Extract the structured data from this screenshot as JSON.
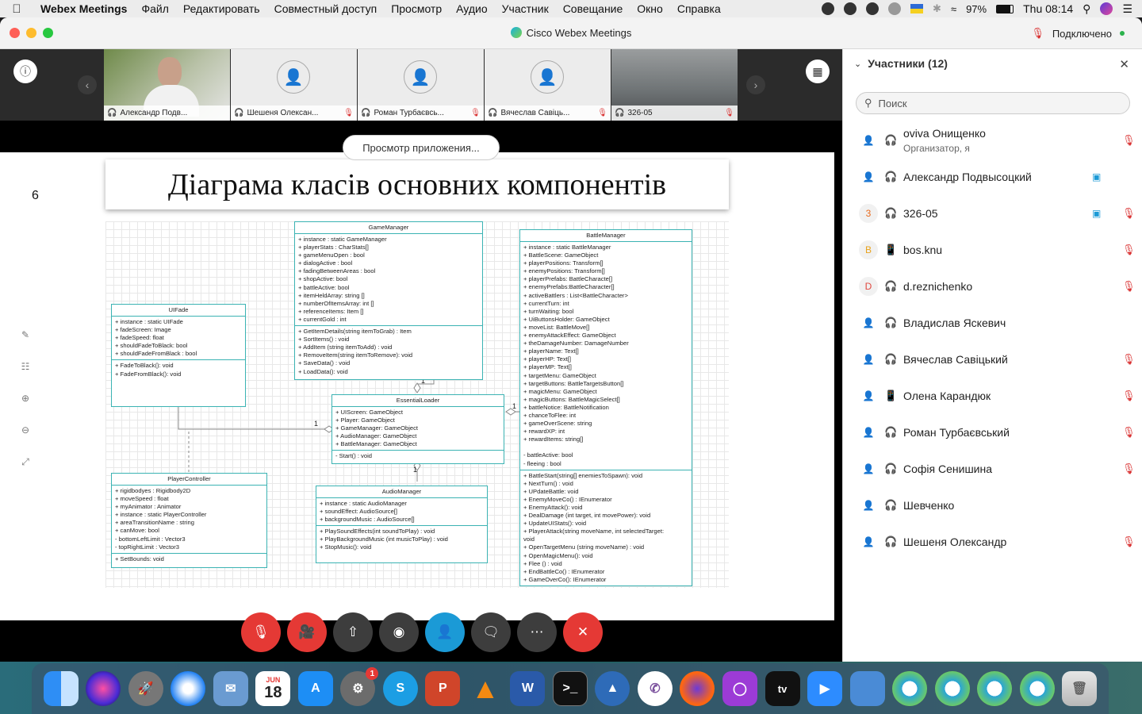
{
  "menubar": {
    "app": "Webex Meetings",
    "items": [
      "Файл",
      "Редактировать",
      "Совместный доступ",
      "Просмотр",
      "Аудио",
      "Участник",
      "Совещание",
      "Окно",
      "Справка"
    ],
    "battery": "97%",
    "clock": "Thu 08:14"
  },
  "window": {
    "title": "Cisco Webex Meetings",
    "status": "Подключено"
  },
  "video_tiles": [
    {
      "name": "Александр Подв...",
      "muted": false
    },
    {
      "name": "Шешеня Олексан...",
      "muted": true
    },
    {
      "name": "Роман Турбаєвсь...",
      "muted": true
    },
    {
      "name": "Вячеслав Савіць...",
      "muted": true
    },
    {
      "name": "326-05",
      "muted": true
    }
  ],
  "share": {
    "view_app_label": "Просмотр приложения..."
  },
  "slide": {
    "number": "6",
    "title": "Діаграма класів основних компонентів",
    "classes": {
      "gamemanager": {
        "name": "GameManager",
        "fields": [
          "+ instance : static GameManager",
          "+ playerStats : CharStats[]",
          "+ gameMenuOpen : bool",
          "+ dialogActive : bool",
          "+ fadingBetweenAreas : bool",
          "+ shopActive: bool",
          "+ battleActive: bool",
          "+ itemHeldArray: string []",
          "+ numberOfItemsArray: int []",
          "+ referenceItems: Item []",
          "+ currentGold : int"
        ],
        "methods": [
          "+ GetItemDetails(string itemToGrab) : Item",
          "+ SortItems() : void",
          "+ AddItem (string itemToAdd) : void",
          "+ RemoveItem(string itemToRemove): void",
          "+ SaveData() : void",
          "+ LoadData(): void"
        ]
      },
      "uifade": {
        "name": "UIFade",
        "fields": [
          "+ instance : static UIFade",
          "+ fadeScreen: Image",
          "+ fadeSpeed: float",
          "+ shouldFadeToBlack: bool",
          "+ shouldFadeFromBlack : bool"
        ],
        "methods": [
          "+ FadeToBlack(): void",
          "+ FadeFromBlack(): void"
        ]
      },
      "essentialloader": {
        "name": "EssentialLoader",
        "fields": [
          "+ UIScreen: GameObject",
          "+ Player: GameObject",
          "+ GameManager: GameObject",
          "+ AudioManager: GameObject",
          "+ BattleManager: GameObject"
        ],
        "methods": [
          "- Start() : void"
        ]
      },
      "playercontroller": {
        "name": "PlayerController",
        "fields": [
          "+ rigidbodyes : Rigidbody2D",
          "+ moveSpeed : float",
          "+ myAnimator : Animator",
          "+ instance : static PlayerController",
          "+ areaTransitionName : string",
          "+ canMove: bool",
          "- bottomLeftLimit : Vector3",
          "- topRightLimit : Vector3"
        ],
        "methods": [
          "+ SetBounds: void"
        ]
      },
      "audiomanager": {
        "name": "AudioManager",
        "fields": [
          "+ instance :  static AudioManager",
          "+ soundEffect: AudioSource[]",
          "+ backgroundMusic : AudioSource[]"
        ],
        "methods": [
          "+ PlaySoundEffects(int soundToPlay) : void",
          "+ PlayBackgroundMusic (int musicToPlay) : void",
          "+ StopMusic(): void"
        ]
      },
      "battlemanager": {
        "name": "BattleManager",
        "fields": [
          "+ instance : static BattleManager",
          "+ BattleScene: GameObject",
          "+ playerPositions: Transform[]",
          "+ enemyPositions: Transform[]",
          "+ playerPrefabs: BattleCharacte[]",
          "+ enemyPrefabs:BattleCharacter[]",
          "+ activeBattlers : List<BattleCharacter>",
          "+ currentTurn: int",
          "+ turnWaiting: bool",
          "+ UiButtonsHolder: GameObject",
          "+ moveList: BattleMove[]",
          "+ enemyAttackEffect: GameObject",
          "+ theDamageNumber: DamageNumber",
          "+ playerName: Text[]",
          "+ playerHP: Text[]",
          "+ playerMP: Text[]",
          "+ targetMenu: GameObject",
          "+ targetButtons: BattleTargetsButton[]",
          "+ magicMenu: GameObject",
          "+ magicButtons: BattleMagicSelect[]",
          "+ battleNotice: BattleNotification",
          "+ chanceToFlee: int",
          "+ gameOverScene: string",
          "+ rewardXP: int",
          "+ rewardItems: string[]",
          "",
          "- battleActive: bool",
          "- fleeing : bool"
        ],
        "methods": [
          "+ BattleStart(string[] enemiesToSpawn): void",
          "+ NextTurn() : void",
          "+ UPdateBattle: void",
          "+ EnemyMoveCo() : IEnumerator",
          "+ EnemyAttack(): void",
          "+ DealDamage (int target, int movePower): void",
          "+ UpdateUIStats(): void",
          "+ PlayerAttack(string moveName, int selectedTarget:",
          "void",
          "+ OpenTargetMenu (string moveName) : void",
          "+ OpenMagicMenu(): void",
          "+ Flee () : void",
          "+ EndBattleCo() : IEnumerator",
          "+ GameOverCo(): IEnumerator"
        ]
      }
    },
    "multiplicity": [
      "1",
      "1",
      "1",
      "1"
    ]
  },
  "participants_panel": {
    "title": "Участники (12)",
    "search_placeholder": "Поиск",
    "participants": [
      {
        "name": "oviva Онищенко",
        "sub": "Организатор, я",
        "avatar": "",
        "device": "headset",
        "cam": false,
        "muted": true
      },
      {
        "name": "Александр Подвысоцкий",
        "sub": "",
        "avatar": "",
        "device": "headset",
        "cam": true,
        "muted": false
      },
      {
        "name": "326-05",
        "sub": "",
        "avatar": "3",
        "device": "headset",
        "cam": true,
        "muted": true
      },
      {
        "name": "bos.knu",
        "sub": "",
        "avatar": "B",
        "device": "phone",
        "cam": false,
        "muted": true
      },
      {
        "name": "d.reznichenko",
        "sub": "",
        "avatar": "D",
        "device": "headset",
        "cam": false,
        "muted": true
      },
      {
        "name": "Владислав Яскевич",
        "sub": "",
        "avatar": "",
        "device": "headset",
        "cam": false,
        "muted": false
      },
      {
        "name": "Вячеслав Савіцький",
        "sub": "",
        "avatar": "",
        "device": "headset",
        "cam": false,
        "muted": true
      },
      {
        "name": "Олена Карандюк",
        "sub": "",
        "avatar": "",
        "device": "phone",
        "cam": false,
        "muted": true
      },
      {
        "name": "Роман Турбаєвський",
        "sub": "",
        "avatar": "",
        "device": "headset",
        "cam": false,
        "muted": true
      },
      {
        "name": "Софія Сенишина",
        "sub": "",
        "avatar": "",
        "device": "headset",
        "cam": false,
        "muted": true
      },
      {
        "name": "Шевченко",
        "sub": "",
        "avatar": "",
        "device": "headset",
        "cam": false,
        "muted": false
      },
      {
        "name": "Шешеня Олександр",
        "sub": "",
        "avatar": "",
        "device": "headset",
        "cam": false,
        "muted": true
      }
    ]
  },
  "dock": {
    "calendar_month": "JUN",
    "calendar_day": "18",
    "prefs_badge": "1",
    "appletv_label": "tv"
  },
  "colors": {
    "accent": "#3bb3b3",
    "mute_red": "#e53935",
    "participants_blue": "#1b9ad6"
  }
}
